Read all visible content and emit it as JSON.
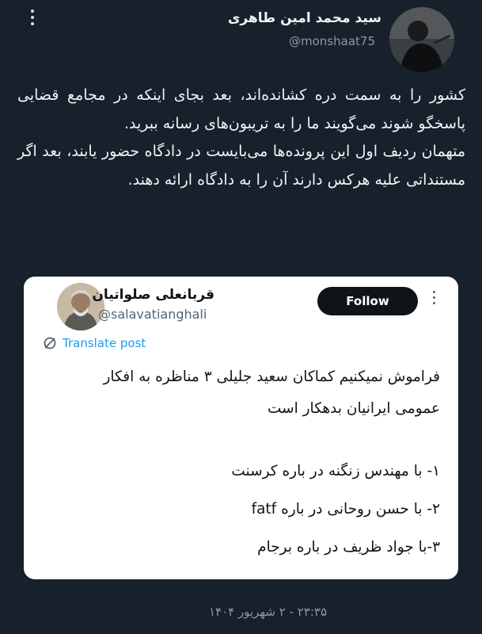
{
  "author": {
    "display_name": "سید محمد امین طاهری",
    "handle": "@monshaat75"
  },
  "tweet": {
    "paragraphs": [
      "کشور را به سمت دره کشانده‌اند، بعد بجای اینکه در مجامع قضایی پاسخگو شوند می‌گویند ما را به تریبون‌های رسانه ببرید.",
      "متهمان ردیف اول این پرونده‌ها می‌بایست در دادگاه حضور یابند، بعد اگر مستنداتی علیه هرکس دارند آن را به دادگاه ارائه دهند."
    ]
  },
  "quoted": {
    "display_name": "قربانعلی صلواتیان",
    "handle": "@salavatianghali",
    "follow_label": "Follow",
    "translate_label": "Translate post",
    "intro_lines": [
      "فراموش نمیکنیم کماکان سعید جلیلی ۳ مناظره به افکار",
      "عمومی ایرانیان بدهکار است"
    ],
    "items": [
      "۱- با مهندس زنگنه در باره کرسنت",
      "۲- با حسن روحانی در باره fatf",
      "۳-با جواد ظریف در باره برجام"
    ]
  },
  "timestamp": "۲۳:۳۵ - ۲ شهریور ۱۴۰۴",
  "icons": {
    "menu": "vertical-ellipsis-icon",
    "translate": "translate-icon"
  },
  "colors": {
    "background": "#17202b",
    "follow_button": "#0f1419",
    "link": "#1d9bf0",
    "muted": "#8b98a5"
  }
}
